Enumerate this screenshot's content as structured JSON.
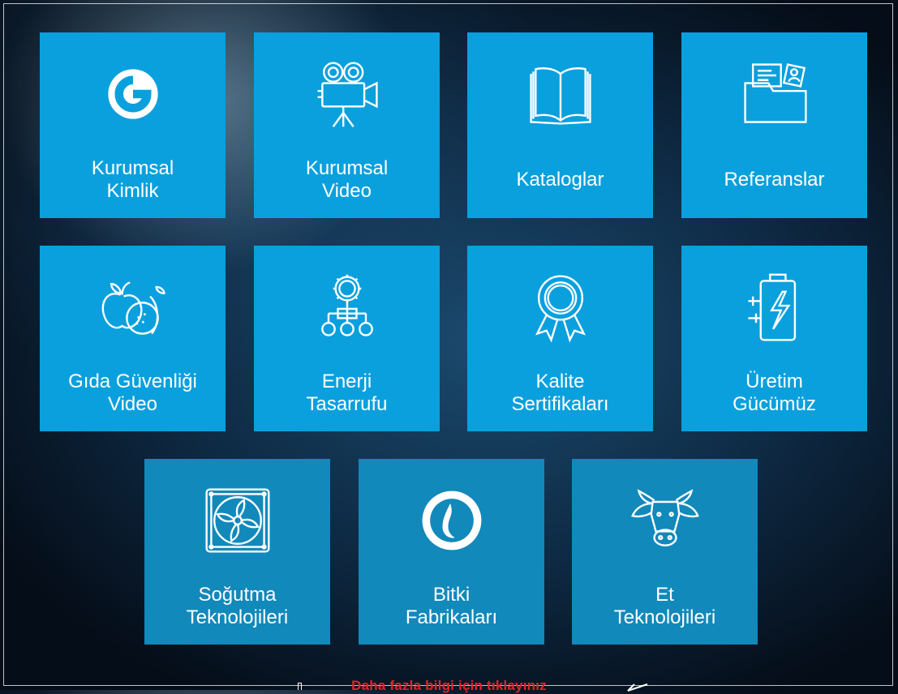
{
  "tiles": [
    {
      "label": "Kurumsal\nKimlik",
      "icon": "brand-logo-icon"
    },
    {
      "label": "Kurumsal\nVideo",
      "icon": "video-camera-icon"
    },
    {
      "label": "Kataloglar",
      "icon": "book-icon"
    },
    {
      "label": "Referanslar",
      "icon": "folder-documents-icon"
    },
    {
      "label": "Gıda Güvenliği\nVideo",
      "icon": "fruits-icon"
    },
    {
      "label": "Enerji\nTasarrufu",
      "icon": "gear-network-icon"
    },
    {
      "label": "Kalite\nSertifikaları",
      "icon": "award-ribbon-icon"
    },
    {
      "label": "Üretim\nGücümüz",
      "icon": "battery-charge-icon"
    },
    {
      "label": "Soğutma\nTeknolojileri",
      "icon": "fan-icon"
    },
    {
      "label": "Bitki\nFabrikaları",
      "icon": "water-drop-circle-icon"
    },
    {
      "label": "Et\nTeknolojileri",
      "icon": "cow-head-icon"
    }
  ],
  "footer": {
    "link_text": "Daha fazla bilgi için tıklayınız"
  },
  "colors": {
    "tile": "#0aa0dd",
    "tile_dark": "#1189bb",
    "footer_link": "#e3222a"
  }
}
